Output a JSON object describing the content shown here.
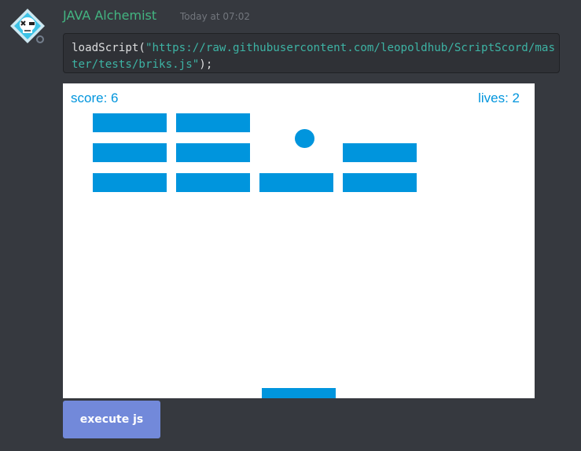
{
  "message": {
    "username": "JAVA Alchemist",
    "timestamp": "Today at 07:02",
    "code": {
      "fn": "loadScript",
      "open": "(",
      "url": "\"https://raw.githubusercontent.com/leopoldhub/ScriptScord/master/tests/briks.js\"",
      "close": ");"
    }
  },
  "game": {
    "score_label": "score: 6",
    "lives_label": "lives: 2",
    "score": 6,
    "lives": 2,
    "brick_grid": {
      "rows": 3,
      "columns": 5,
      "present": [
        [
          true,
          true,
          false,
          false,
          false
        ],
        [
          true,
          true,
          false,
          true,
          false
        ],
        [
          true,
          true,
          true,
          true,
          false
        ]
      ]
    },
    "colors": {
      "background": "#ffffff",
      "accent": "#0095dd"
    }
  },
  "action": {
    "execute_label": "execute js"
  },
  "colors": {
    "app_background": "#36393f",
    "username": "#43b581",
    "button": "#7289da"
  },
  "icons": {
    "avatar": "skull-avatar-icon",
    "status": "offline-status-icon"
  }
}
